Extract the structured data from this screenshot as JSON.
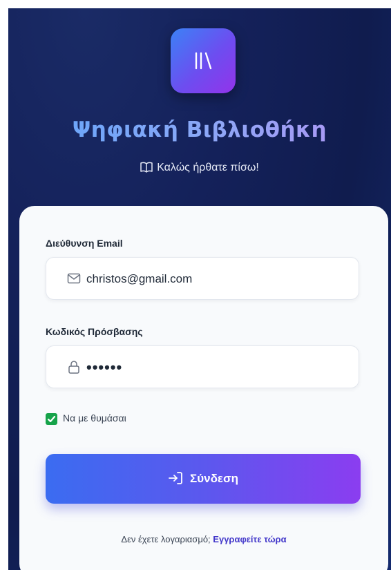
{
  "header": {
    "logo_icon": "library-icon",
    "title": "Ψηφιακή Βιβλιοθήκη",
    "subtitle_icon": "open-book-icon",
    "subtitle": "Καλώς ήρθατε πίσω!"
  },
  "form": {
    "email_label": "Διεύθυνση Email",
    "email_icon": "mail-icon",
    "email_value": "christos@gmail.com",
    "password_label": "Κωδικός Πρόσβασης",
    "password_icon": "lock-icon",
    "password_value": "••••••",
    "remember_checked": true,
    "remember_label": "Να με θυμάσαι",
    "submit_icon": "log-in-icon",
    "submit_label": "Σύνδεση"
  },
  "footer": {
    "prompt": "Δεν έχετε λογαριασμό;",
    "register_link": "Εγγραφείτε τώρα"
  },
  "colors": {
    "accent_start": "#3b82f6",
    "accent_end": "#9333ea",
    "checkbox": "#16a34a",
    "link": "#4338ca"
  }
}
